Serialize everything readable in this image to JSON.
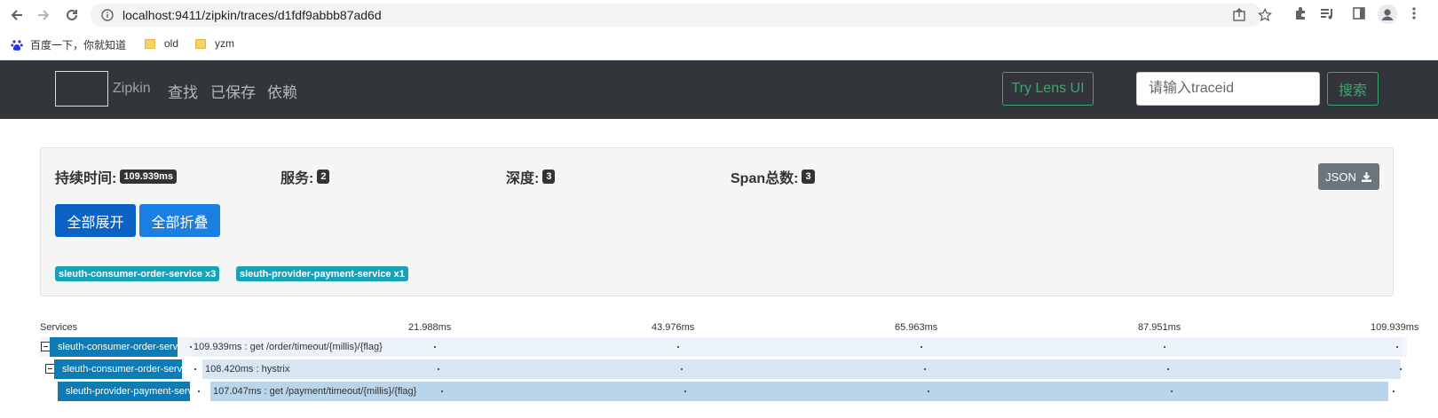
{
  "browser": {
    "url": "localhost:9411/zipkin/traces/d1fdf9abbb87ad6d",
    "bookmarks": [
      {
        "label": "百度一下，你就知道",
        "icon": "baidu-paw-icon"
      },
      {
        "label": "old",
        "icon": "folder-icon"
      },
      {
        "label": "yzm",
        "icon": "folder-icon"
      }
    ]
  },
  "navbar": {
    "brand": "Zipkin",
    "links": [
      "查找",
      "已保存",
      "依赖"
    ],
    "lens_button": "Try Lens UI",
    "trace_placeholder": "请输入traceid",
    "search_button": "搜索"
  },
  "summary": {
    "duration_label": "持续时间:",
    "duration_value": "109.939ms",
    "services_label": "服务:",
    "services_value": "2",
    "depth_label": "深度:",
    "depth_value": "3",
    "spans_label": "Span总数:",
    "spans_value": "3",
    "json_button": "JSON",
    "expand_all": "全部展开",
    "collapse_all": "全部折叠",
    "service_tags": [
      "sleuth-consumer-order-service x3",
      "sleuth-provider-payment-service x1"
    ]
  },
  "timeline": {
    "services_header": "Services",
    "ticks": [
      "21.988ms",
      "43.976ms",
      "65.963ms",
      "87.951ms",
      "109.939ms"
    ],
    "spans": [
      {
        "service": "sleuth-consumer-order-service",
        "text": "109.939ms : get /order/timeout/{millis}/{flag}"
      },
      {
        "service": "sleuth-consumer-order-service",
        "text": "108.420ms : hystrix"
      },
      {
        "service": "sleuth-provider-payment-service",
        "text": "107.047ms : get /payment/timeout/{millis}/{flag}"
      }
    ]
  },
  "colors": {
    "navbar_bg": "#32363a",
    "accent_green": "#3aa76d",
    "service_tag": "#17a2b8",
    "service_label": "#0f7bb5",
    "button_blue": "#1a7fe0"
  }
}
